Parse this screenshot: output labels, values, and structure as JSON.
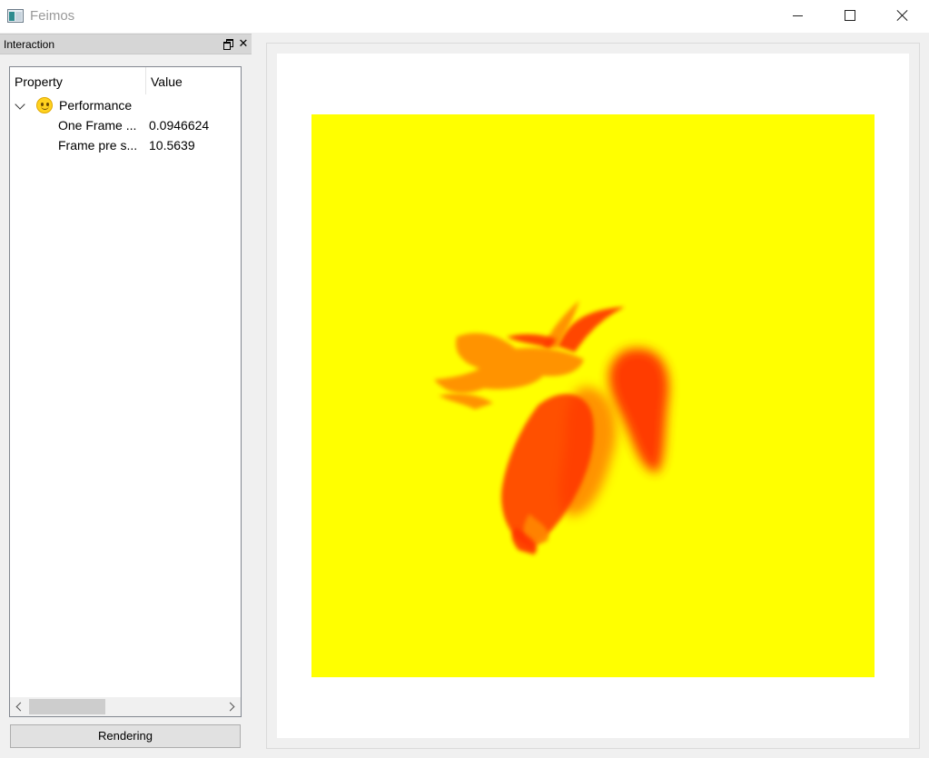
{
  "window": {
    "title": "Feimos"
  },
  "dock": {
    "title": "Interaction"
  },
  "tree": {
    "columns": {
      "property": "Property",
      "value": "Value"
    },
    "group": {
      "label": "Performance",
      "icon": "smiley-icon"
    },
    "items": [
      {
        "name": "One Frame ...",
        "value": "0.0946624"
      },
      {
        "name": "Frame pre s...",
        "value": "10.5639"
      }
    ]
  },
  "buttons": {
    "rendering": "Rendering"
  },
  "viewport": {
    "background_color": "#ffff00",
    "subject_colors": [
      "#ff3300",
      "#ff8800"
    ]
  }
}
